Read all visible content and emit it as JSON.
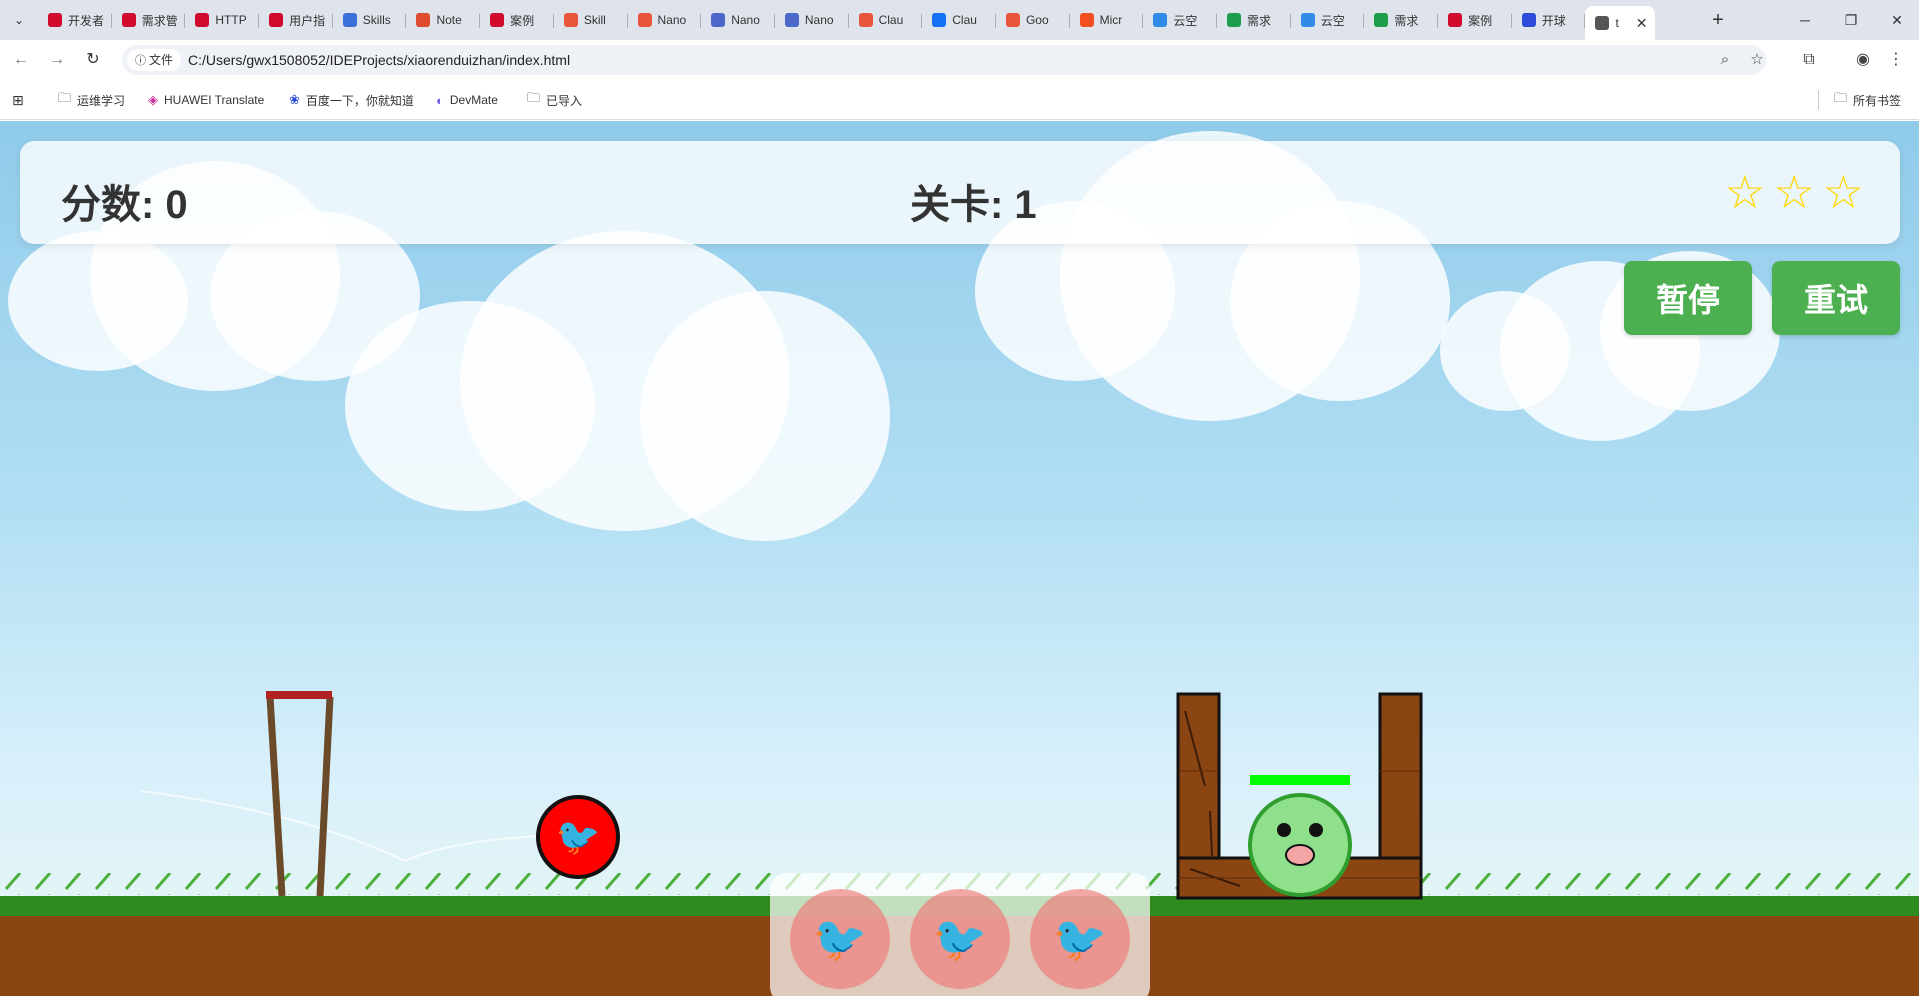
{
  "browser": {
    "tabs": [
      {
        "title": "开发者",
        "icon": "huawei-icon",
        "color": "#cf0a2c"
      },
      {
        "title": "需求管",
        "icon": "huawei-icon",
        "color": "#cf0a2c"
      },
      {
        "title": "HTTP",
        "icon": "huawei-icon",
        "color": "#cf0a2c"
      },
      {
        "title": "用户指",
        "icon": "huawei-icon",
        "color": "#cf0a2c"
      },
      {
        "title": "Skills",
        "icon": "skills-icon",
        "color": "#3b6fd8"
      },
      {
        "title": "Note",
        "icon": "note-icon",
        "color": "#e04a2f"
      },
      {
        "title": "案例",
        "icon": "huawei-icon",
        "color": "#cf0a2c"
      },
      {
        "title": "Skill",
        "icon": "nano-icon",
        "color": "#e8553d"
      },
      {
        "title": "Nano",
        "icon": "nano-icon",
        "color": "#e8553d"
      },
      {
        "title": "Nano",
        "icon": "chevron-icon",
        "color": "#4a67c9"
      },
      {
        "title": "Nano",
        "icon": "chevron-icon",
        "color": "#4a67c9"
      },
      {
        "title": "Clau",
        "icon": "nano-icon",
        "color": "#e8553d"
      },
      {
        "title": "Clau",
        "icon": "zhihu-icon",
        "color": "#1772f6"
      },
      {
        "title": "Goo",
        "icon": "nano-icon",
        "color": "#e8553d"
      },
      {
        "title": "Micr",
        "icon": "microsoft-icon",
        "color": "#f25022"
      },
      {
        "title": "云空",
        "icon": "cloud-icon",
        "color": "#2f8be6"
      },
      {
        "title": "需求",
        "icon": "sheet-icon",
        "color": "#1e9e4a"
      },
      {
        "title": "云空",
        "icon": "cloud-icon",
        "color": "#2f8be6"
      },
      {
        "title": "需求",
        "icon": "sheet-icon",
        "color": "#1e9e4a"
      },
      {
        "title": "案例",
        "icon": "huawei-icon",
        "color": "#cf0a2c"
      },
      {
        "title": "开球",
        "icon": "paw-icon",
        "color": "#2b4bd8"
      },
      {
        "title": "t",
        "icon": "globe-icon",
        "color": "#555555"
      }
    ],
    "address": {
      "chip": "文件",
      "url": "C:/Users/gwx1508052/IDEProjects/xiaorenduizhan/index.html"
    },
    "bookmarks": [
      {
        "label": "运维学习",
        "icon": "folder-icon"
      },
      {
        "label": "HUAWEI Translate",
        "icon": "translate-icon"
      },
      {
        "label": "百度一下，你就知道",
        "icon": "baidu-icon"
      },
      {
        "label": "DevMate",
        "icon": "devmate-icon"
      },
      {
        "label": "已导入",
        "icon": "folder-icon"
      }
    ],
    "all_bookmarks": "所有书签"
  },
  "game": {
    "score_label": "分数: 0",
    "level_label": "关卡: 1",
    "stars": [
      "☆",
      "☆",
      "☆"
    ],
    "stars_earned": 0,
    "pause_label": "暂停",
    "retry_label": "重试",
    "remaining_birds": 3,
    "pig_health": 1.0,
    "colors": {
      "button": "#4caf50",
      "star": "#ffd700",
      "bird": "#ff0000",
      "pig": "#8fe08a",
      "wood": "#8b4513",
      "grass": "#2e8b1e",
      "dirt": "#8b4513",
      "health": "#00ff00",
      "slingshot_top": "#b22222"
    }
  }
}
